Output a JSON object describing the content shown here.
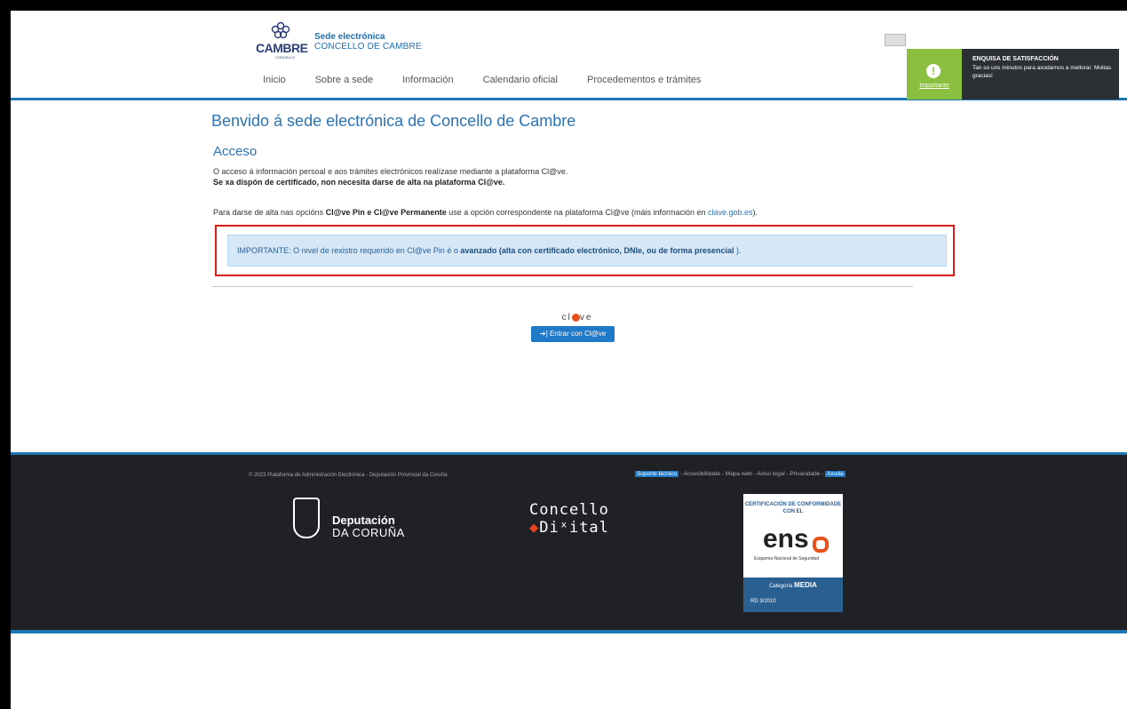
{
  "header": {
    "logo_name": "CAMBRE",
    "logo_small": "CONCELLO",
    "site_title": "Sede electrónica",
    "site_subtitle": "CONCELLO DE CAMBRE",
    "nav": [
      "Inicio",
      "Sobre a sede",
      "Información",
      "Calendario oficial",
      "Procedementos e trámites"
    ]
  },
  "survey": {
    "badge_label": "Importante",
    "title": "ENQUISA DE SATISFACCIÓN",
    "text": "Tan so uns minutos para axudarnos a mellorar. Moitas gracias!"
  },
  "main": {
    "page_title": "Benvido á sede electrónica de Concello de Cambre",
    "section_title": "Acceso",
    "paragraph1": "O acceso á información persoal e aos trámites electrónicos realízase mediante a plataforma Cl@ve.",
    "paragraph2": "Se xa dispón de certificado, non necesita darse de alta na plataforma Cl@ve.",
    "paragraph3_pre": "Para darse de alta nas opcións ",
    "paragraph3_bold": "Cl@ve Pin e Cl@ve Permanente",
    "paragraph3_mid": " use a opción correspondente na plataforma Cl@ve (máis información en ",
    "paragraph3_link": "clave.gob.es",
    "paragraph3_post": ").",
    "alert_pre": "IMPORTANTE: O nivel de rexistro requerido en Cl@ve Pin é o ",
    "alert_bold": "avanzado (alta con certificado electrónico, DNIe, ou de forma presencial",
    "alert_post": " ).",
    "clave_logo": "cl ve",
    "clave_button": "Entrar con Cl@ve"
  },
  "footer": {
    "copyright": "© 2023 Plataforma de Administración Electrónica - Deputación Provincial da Coruña",
    "links": {
      "support": "Soporte técnico",
      "sep1": " - Accesibilidade - Mapa web - Aviso legal - Privacidade - ",
      "help": "Axuda"
    },
    "deputacion_name": "Deputación",
    "deputacion_sub": "DA CORUÑA",
    "concello_line1": "Concello",
    "concello_line2": "Diˣital",
    "ens_cert": "CERTIFICACIÓN DE CONFORMIDADE CON EL",
    "ens_word": "ens",
    "ens_sub": "Esquema Nacional de Seguridad",
    "ens_category_label": "Categoría",
    "ens_category": "MEDIA",
    "ens_rd": "RD 3/2010"
  },
  "colors": {
    "accent": "#1f78b4",
    "highlight_outline": "#d91e18",
    "survey_badge": "#8bbf3f",
    "footer_bg": "#1f2124"
  }
}
